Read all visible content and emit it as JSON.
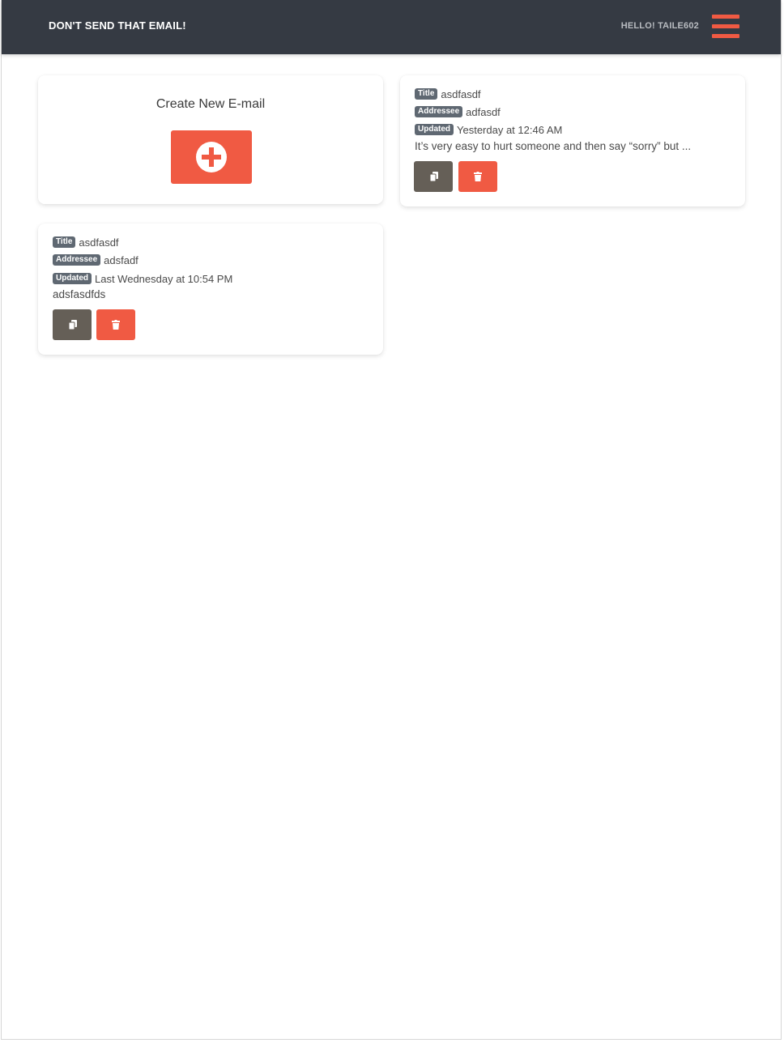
{
  "header": {
    "brand": "DON'T SEND THAT EMAIL!",
    "greeting": "HELLO! TAILE602",
    "menu_icon": "hamburger-menu-icon"
  },
  "create_card": {
    "title": "Create New E-mail",
    "button_icon": "plus-circle-icon"
  },
  "emails": [
    {
      "title_badge": "Title",
      "title": "asdfasdf",
      "addressee_badge": "Addressee",
      "addressee": "adfasdf",
      "updated_badge": "Updated",
      "updated": "Yesterday at 12:46 AM",
      "body": "It’s very easy to hurt someone and then say “sorry” but ...",
      "copy_icon": "copy-icon",
      "delete_icon": "trash-icon"
    },
    {
      "title_badge": "Title",
      "title": "asdfasdf",
      "addressee_badge": "Addressee",
      "addressee": "adsfadf",
      "updated_badge": "Updated",
      "updated": "Last Wednesday at 10:54 PM",
      "body": "adsfasdfds",
      "copy_icon": "copy-icon",
      "delete_icon": "trash-icon"
    }
  ],
  "colors": {
    "navbar": "#353a43",
    "accent": "#f05a43",
    "copy_button": "#655f57",
    "badge": "#5f6872"
  }
}
